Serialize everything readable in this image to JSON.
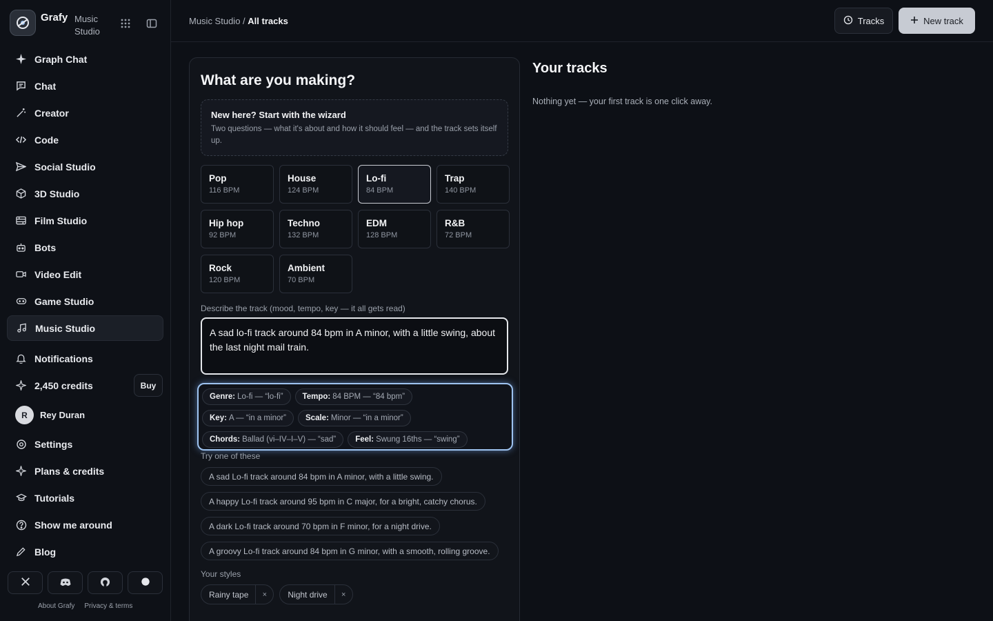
{
  "brand": {
    "name": "Grafy",
    "sub": "Music Studio"
  },
  "nav": [
    {
      "label": "Graph Chat",
      "icon": "sparkle-icon"
    },
    {
      "label": "Chat",
      "icon": "message-icon"
    },
    {
      "label": "Creator",
      "icon": "wand-icon"
    },
    {
      "label": "Code",
      "icon": "code-icon"
    },
    {
      "label": "Social Studio",
      "icon": "send-icon"
    },
    {
      "label": "3D Studio",
      "icon": "cube-icon"
    },
    {
      "label": "Film Studio",
      "icon": "film-icon"
    },
    {
      "label": "Bots",
      "icon": "bot-icon"
    },
    {
      "label": "Video Edit",
      "icon": "video-icon"
    },
    {
      "label": "Game Studio",
      "icon": "gamepad-icon"
    },
    {
      "label": "Music Studio",
      "icon": "music-icon"
    }
  ],
  "nav_bottom": {
    "notifications": "Notifications",
    "credits": "2,450 credits",
    "buy": "Buy",
    "user_initial": "R",
    "user_name": "Rey Duran",
    "settings": "Settings",
    "plans": "Plans & credits",
    "tutorials": "Tutorials",
    "tour": "Show me around",
    "blog": "Blog"
  },
  "footer": {
    "about": "About Grafy",
    "privacy": "Privacy & terms"
  },
  "topbar": {
    "crumb_parent": "Music Studio",
    "crumb_sep": "/",
    "crumb_current": "All tracks",
    "tracks_btn": "Tracks",
    "new_btn": "New track"
  },
  "builder": {
    "title": "What are you making?",
    "wizard_title": "New here? Start with the wizard",
    "wizard_desc": "Two questions — what it's about and how it should feel — and the track sets itself up.",
    "genres": [
      {
        "name": "Pop",
        "bpm": "116 BPM"
      },
      {
        "name": "House",
        "bpm": "124 BPM"
      },
      {
        "name": "Lo-fi",
        "bpm": "84 BPM"
      },
      {
        "name": "Trap",
        "bpm": "140 BPM"
      },
      {
        "name": "Hip hop",
        "bpm": "92 BPM"
      },
      {
        "name": "Techno",
        "bpm": "132 BPM"
      },
      {
        "name": "EDM",
        "bpm": "128 BPM"
      },
      {
        "name": "R&B",
        "bpm": "72 BPM"
      },
      {
        "name": "Rock",
        "bpm": "120 BPM"
      },
      {
        "name": "Ambient",
        "bpm": "70 BPM"
      }
    ],
    "selected_genre": "Lo-fi",
    "describe_label": "Describe the track (mood, tempo, key — it all gets read)",
    "prompt_value": "A sad lo-fi track around 84 bpm in A minor, with a little swing, about the last night mail train.",
    "detected": [
      {
        "key": "Genre:",
        "value": "Lo-fi — “lo-fi”"
      },
      {
        "key": "Tempo:",
        "value": "84 BPM — “84 bpm”"
      },
      {
        "key": "Key:",
        "value": "A — “in a minor”"
      },
      {
        "key": "Scale:",
        "value": "Minor — “in a minor”"
      },
      {
        "key": "Chords:",
        "value": "Ballad (vi–IV–I–V) — “sad”"
      },
      {
        "key": "Feel:",
        "value": "Swung 16ths — “swing”"
      }
    ],
    "try_label": "Try one of these",
    "suggestions": [
      "A sad Lo-fi track around 84 bpm in A minor, with a little swing.",
      "A happy Lo-fi track around 95 bpm in C major, for a bright, catchy chorus.",
      "A dark Lo-fi track around 70 bpm in F minor, for a night drive.",
      "A groovy Lo-fi track around 84 bpm in G minor, with a smooth, rolling groove."
    ],
    "styles_label": "Your styles",
    "styles": [
      "Rainy tape",
      "Night drive"
    ],
    "remove_glyph": "×"
  },
  "tracks": {
    "title": "Your tracks",
    "empty": "Nothing yet — your first track is one click away."
  }
}
